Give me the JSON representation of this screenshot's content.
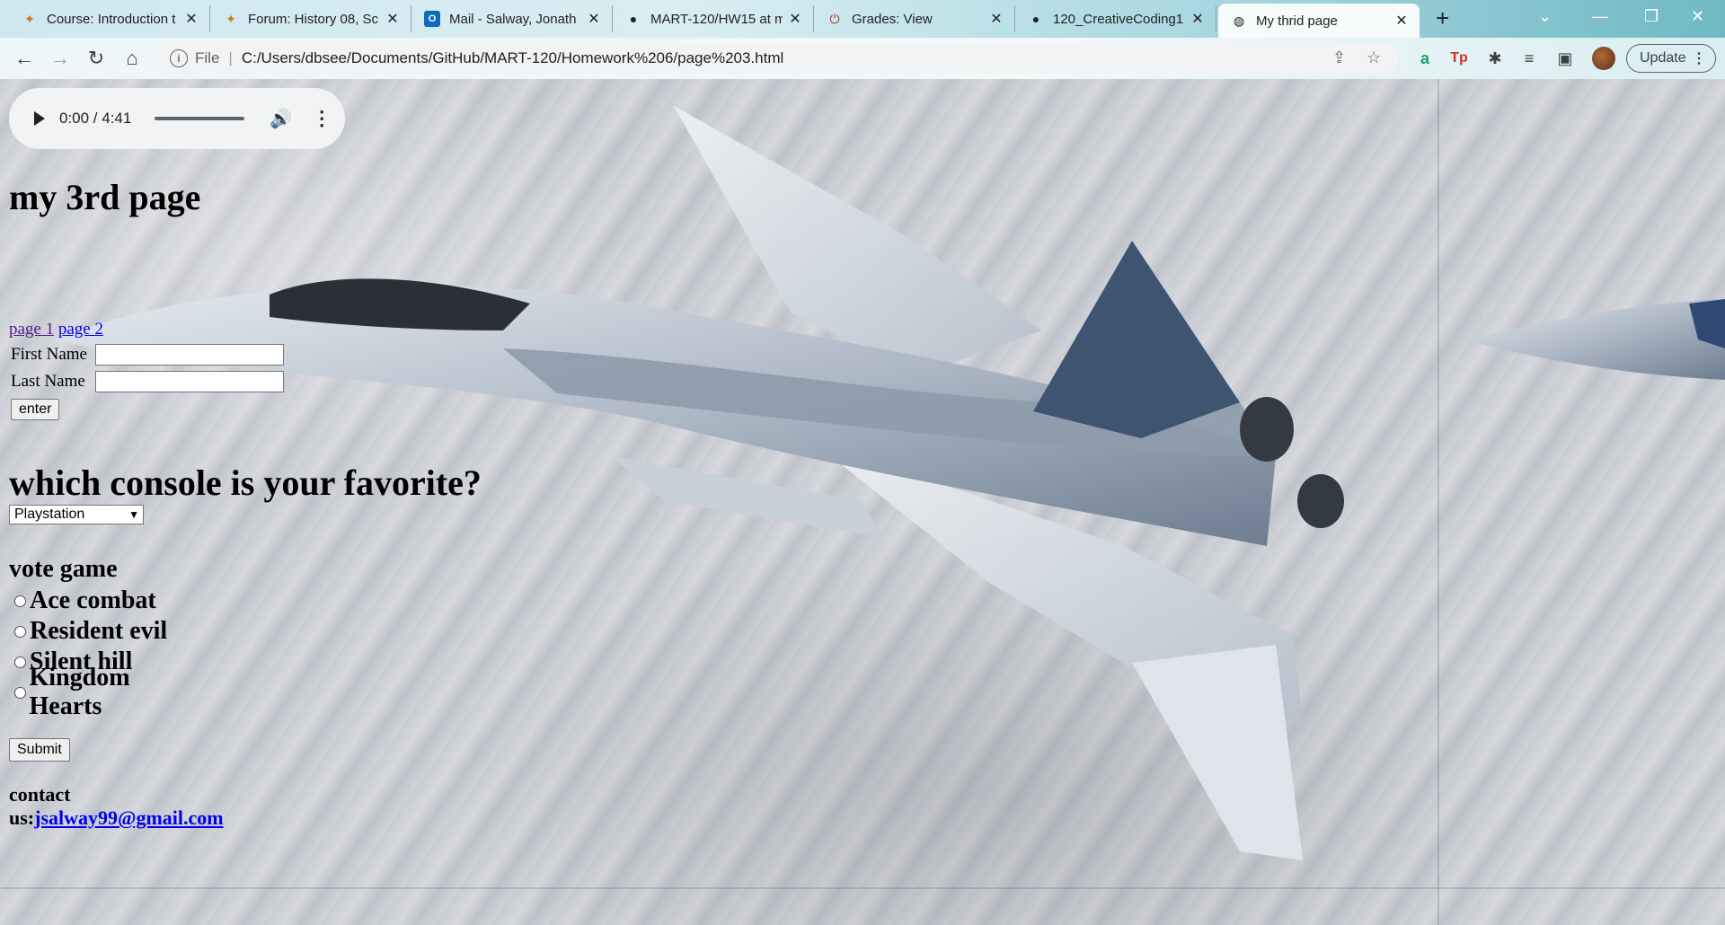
{
  "browser": {
    "tabs": [
      {
        "title": "Course: Introduction t",
        "icon": "course-icon",
        "active": false
      },
      {
        "title": "Forum: History 08, Sc",
        "icon": "forum-icon",
        "active": false
      },
      {
        "title": "Mail - Salway, Jonath",
        "icon": "outlook-icon",
        "active": false
      },
      {
        "title": "MART-120/HW15 at m",
        "icon": "github-icon",
        "active": false
      },
      {
        "title": "Grades: View",
        "icon": "power-icon",
        "active": false
      },
      {
        "title": "120_CreativeCoding1",
        "icon": "github-icon",
        "active": false
      },
      {
        "title": "My thrid page",
        "icon": "globe-icon",
        "active": true
      }
    ],
    "address": {
      "scheme": "File",
      "url": "C:/Users/dbsee/Documents/GitHub/MART-120/Homework%206/page%203.html"
    },
    "update_label": "Update"
  },
  "page": {
    "audio": {
      "time": "0:00 / 4:41"
    },
    "title": "my 3rd page",
    "links": [
      "page 1",
      "page 2"
    ],
    "form": {
      "first_name_label": "First Name",
      "last_name_label": "Last Name",
      "first_name_value": "",
      "last_name_value": "",
      "enter_label": "enter"
    },
    "console_question": "which console is your favorite?",
    "console_selected": "Playstation",
    "vote_heading": "vote game",
    "vote_options": [
      "Ace combat",
      "Resident evil",
      "Silent hill",
      "Kingdom Hearts"
    ],
    "submit_label": "Submit",
    "contact_label": "contact us:",
    "contact_email": "jsalway99@gmail.com"
  }
}
